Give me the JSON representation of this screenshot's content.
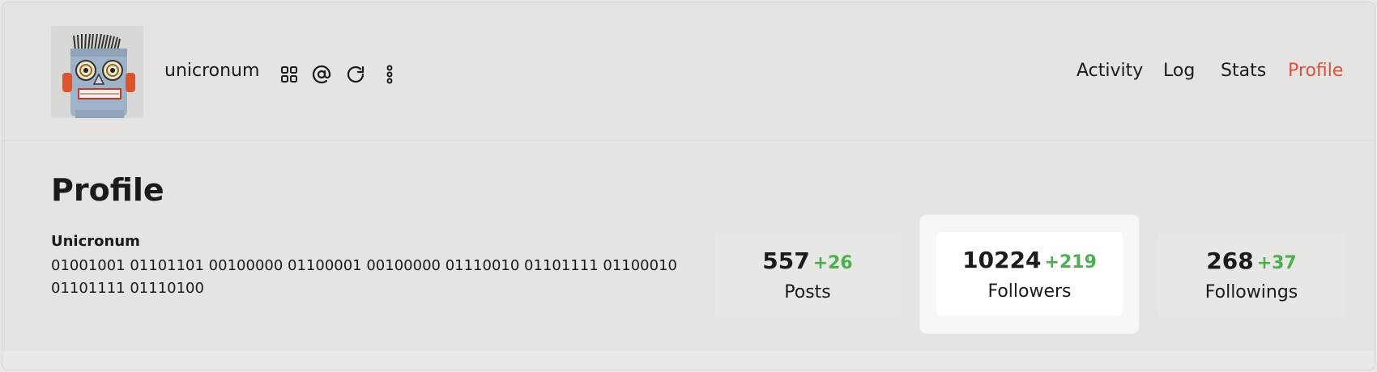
{
  "header": {
    "username": "unicronum",
    "icons": [
      "grid-icon",
      "at-icon",
      "refresh-icon",
      "more-vertical-icon"
    ]
  },
  "nav": {
    "items": [
      {
        "label": "Activity",
        "active": false
      },
      {
        "label": "Log",
        "active": false
      },
      {
        "label": "Stats",
        "active": false
      },
      {
        "label": "Profile",
        "active": true
      }
    ]
  },
  "page": {
    "title": "Profile",
    "bio_name": "Unicronum",
    "bio_text": "01001001 01101101 00100000 01100001 00100000 01110010 01101111 01100010 01101111 01110100"
  },
  "stats": [
    {
      "value": "557",
      "delta": "+26",
      "label": "Posts"
    },
    {
      "value": "10224",
      "delta": "+219",
      "label": "Followers",
      "selected": true
    },
    {
      "value": "268",
      "delta": "+37",
      "label": "Followings"
    }
  ],
  "colors": {
    "accent": "#d9523e",
    "positive": "#4caf50",
    "background": "#e5e4e3"
  }
}
